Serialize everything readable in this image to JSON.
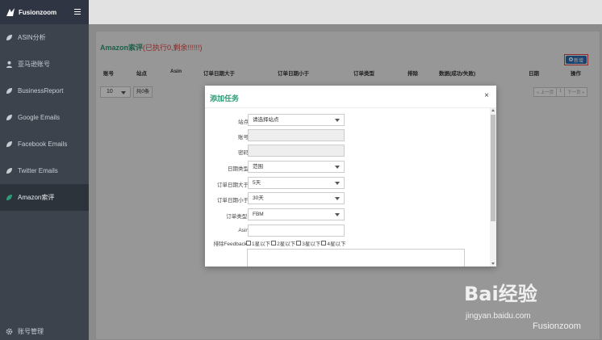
{
  "brand": {
    "name": "Fusionzoom"
  },
  "sidebar": {
    "items": [
      {
        "label": "ASIN分析",
        "icon": "leaf-icon",
        "active": false
      },
      {
        "label": "亚马逊账号",
        "icon": "user-icon",
        "active": false
      },
      {
        "label": "BusinessReport",
        "icon": "leaf-icon",
        "active": false
      },
      {
        "label": "Google Emails",
        "icon": "leaf-icon",
        "active": false
      },
      {
        "label": "Facebook Emails",
        "icon": "leaf-icon",
        "active": false
      },
      {
        "label": "Twitter Emails",
        "icon": "leaf-icon",
        "active": false
      },
      {
        "label": "Amazon索评",
        "icon": "leaf-icon",
        "active": true
      }
    ],
    "bottom": {
      "label": "账号管理",
      "icon": "gear-icon"
    }
  },
  "main": {
    "title": "Amazon索评",
    "title_sub": "(已执行0,剩余!!!!!!)",
    "add_label": "新增",
    "columns": [
      "账号",
      "站点",
      "Asin",
      "订单日期大于",
      "订单日期小于",
      "订单类型",
      "排除",
      "数据(成功/失败)",
      "日期",
      "操作"
    ],
    "page_size": "10",
    "total": "共0条",
    "pager": {
      "prev": "« 上一页",
      "current": "1",
      "next": "下一页 »"
    }
  },
  "modal": {
    "title": "添加任务",
    "close": "×",
    "fields": {
      "site": {
        "label": "站点",
        "value": "请选择站点"
      },
      "account": {
        "label": "账号",
        "value": ""
      },
      "password": {
        "label": "密码",
        "value": ""
      },
      "date_type": {
        "label": "日期类型",
        "value": "范围"
      },
      "order_date_gt": {
        "label": "订单日期大于",
        "value": "5天"
      },
      "order_date_lt": {
        "label": "订单日期小于",
        "value": "30天"
      },
      "order_type": {
        "label": "订单类型:",
        "value": "FBM"
      },
      "asin": {
        "label": "Asin",
        "value": ""
      }
    },
    "exclude": {
      "label": "排除Feedback",
      "options": [
        "1星以下",
        "2星以下",
        "3星以下",
        "4星以下"
      ]
    }
  },
  "watermark": {
    "logo": "Bai经验",
    "url": "jingyan.baidu.com",
    "user": "Fusionzoom"
  }
}
